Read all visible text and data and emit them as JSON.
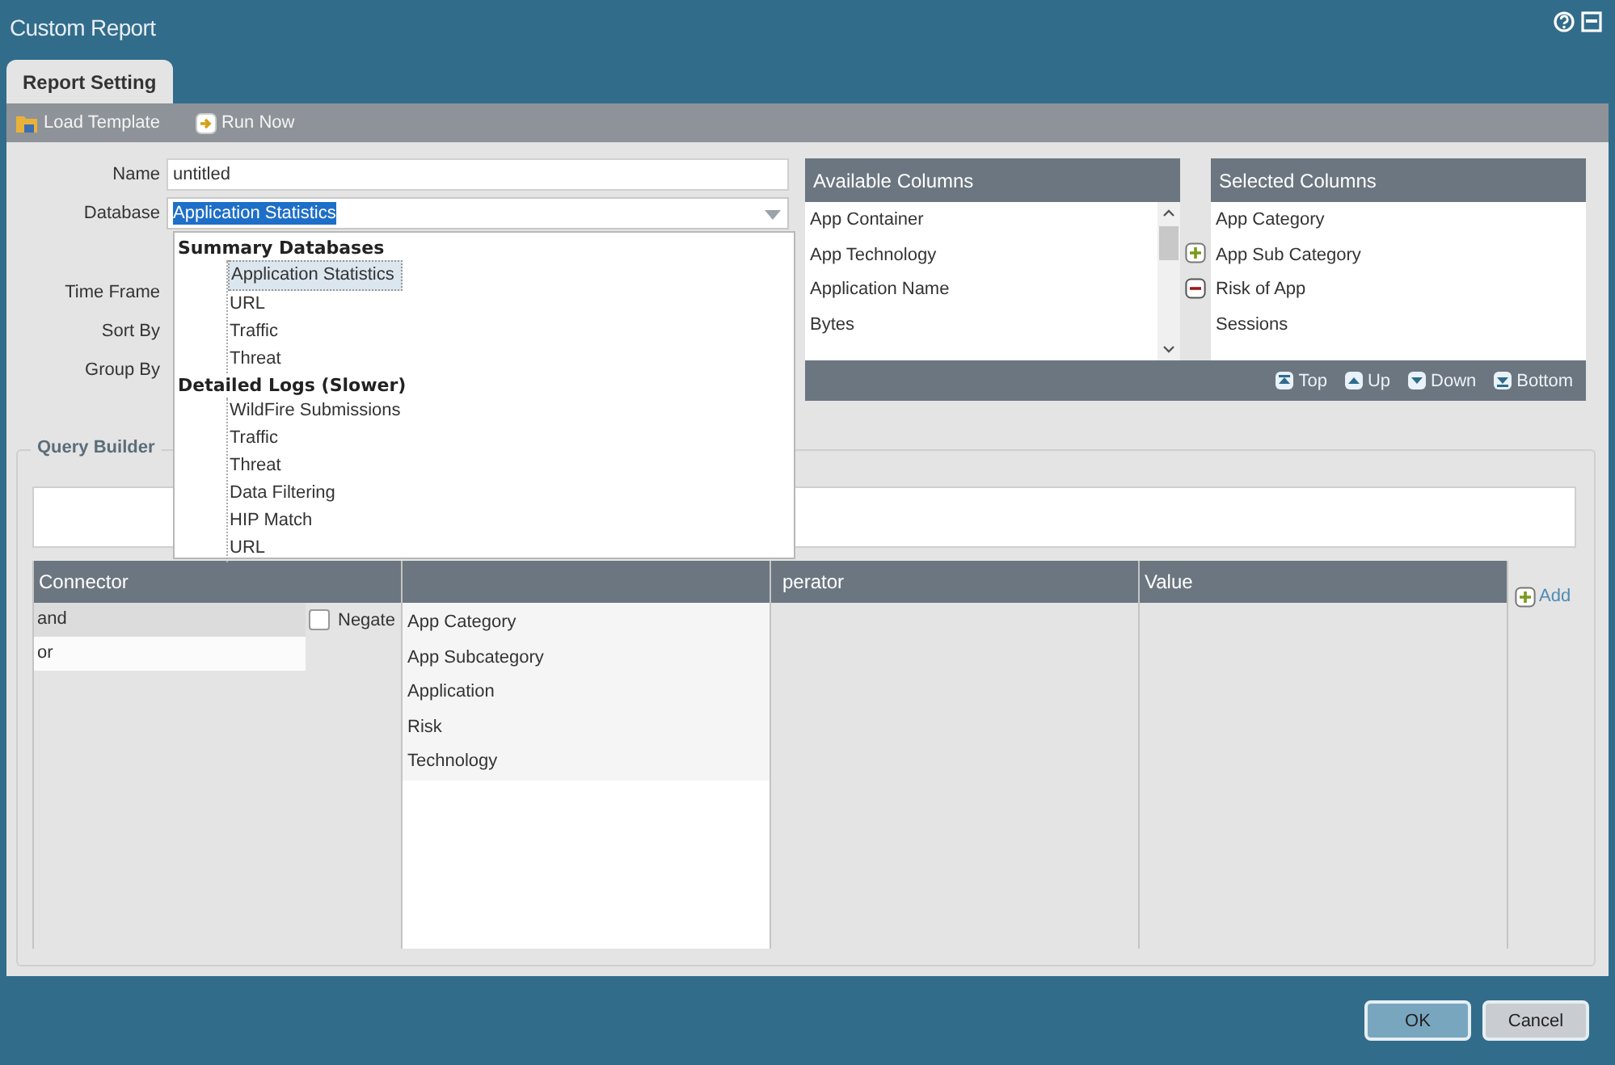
{
  "window": {
    "title": "Custom Report"
  },
  "tabs": [
    {
      "label": "Report Setting",
      "selected": true
    }
  ],
  "toolbar": [
    {
      "label": "Load Template",
      "kind": "load"
    },
    {
      "label": "Run Now",
      "kind": "run"
    }
  ],
  "form": {
    "name": {
      "label": "Name",
      "value": "untitled"
    },
    "database": {
      "label": "Database",
      "value": "Application Statistics"
    },
    "other_labels": [
      "Time Frame",
      "Sort By",
      "Group By"
    ]
  },
  "database_dropdown": {
    "groups": [
      {
        "label": "Summary Databases",
        "items": [
          {
            "label": "Application Statistics",
            "selected": true
          },
          {
            "label": "URL",
            "selected": false
          },
          {
            "label": "Traffic",
            "selected": false
          },
          {
            "label": "Threat",
            "selected": false
          }
        ]
      },
      {
        "label": "Detailed Logs (Slower)",
        "items": [
          {
            "label": "WildFire Submissions",
            "selected": false
          },
          {
            "label": "Traffic",
            "selected": false
          },
          {
            "label": "Threat",
            "selected": false
          },
          {
            "label": "Data Filtering",
            "selected": false
          },
          {
            "label": "HIP Match",
            "selected": false
          },
          {
            "label": "URL",
            "selected": false
          }
        ]
      }
    ]
  },
  "available_columns": {
    "title": "Available Columns",
    "items": [
      "App Container",
      "App Technology",
      "Application Name",
      "Bytes"
    ]
  },
  "selected_columns": {
    "title": "Selected Columns",
    "items": [
      "App Category",
      "App Sub Category",
      "Risk of App",
      "Sessions"
    ]
  },
  "order_buttons": [
    {
      "label": "Top",
      "kind": "top"
    },
    {
      "label": "Up",
      "kind": "up"
    },
    {
      "label": "Down",
      "kind": "down"
    },
    {
      "label": "Bottom",
      "kind": "bottom"
    }
  ],
  "query_builder": {
    "title": "Query Builder",
    "columns": [
      {
        "label": "Connector",
        "kind": "connector"
      },
      {
        "kind": "attribute"
      },
      {
        "label": "perator",
        "kind": "operator"
      },
      {
        "label": "Value",
        "kind": "value"
      }
    ],
    "connectors": [
      {
        "label": "and",
        "selected": true
      },
      {
        "label": "or",
        "selected": false
      }
    ],
    "negate": {
      "label": "Negate",
      "checked": false
    },
    "attributes": [
      "App Category",
      "App Subcategory",
      "Application",
      "Risk",
      "Technology"
    ],
    "add_label": "Add"
  },
  "buttons": [
    {
      "label": "OK",
      "kind": "primary"
    },
    {
      "label": "Cancel",
      "kind": "secondary"
    }
  ]
}
